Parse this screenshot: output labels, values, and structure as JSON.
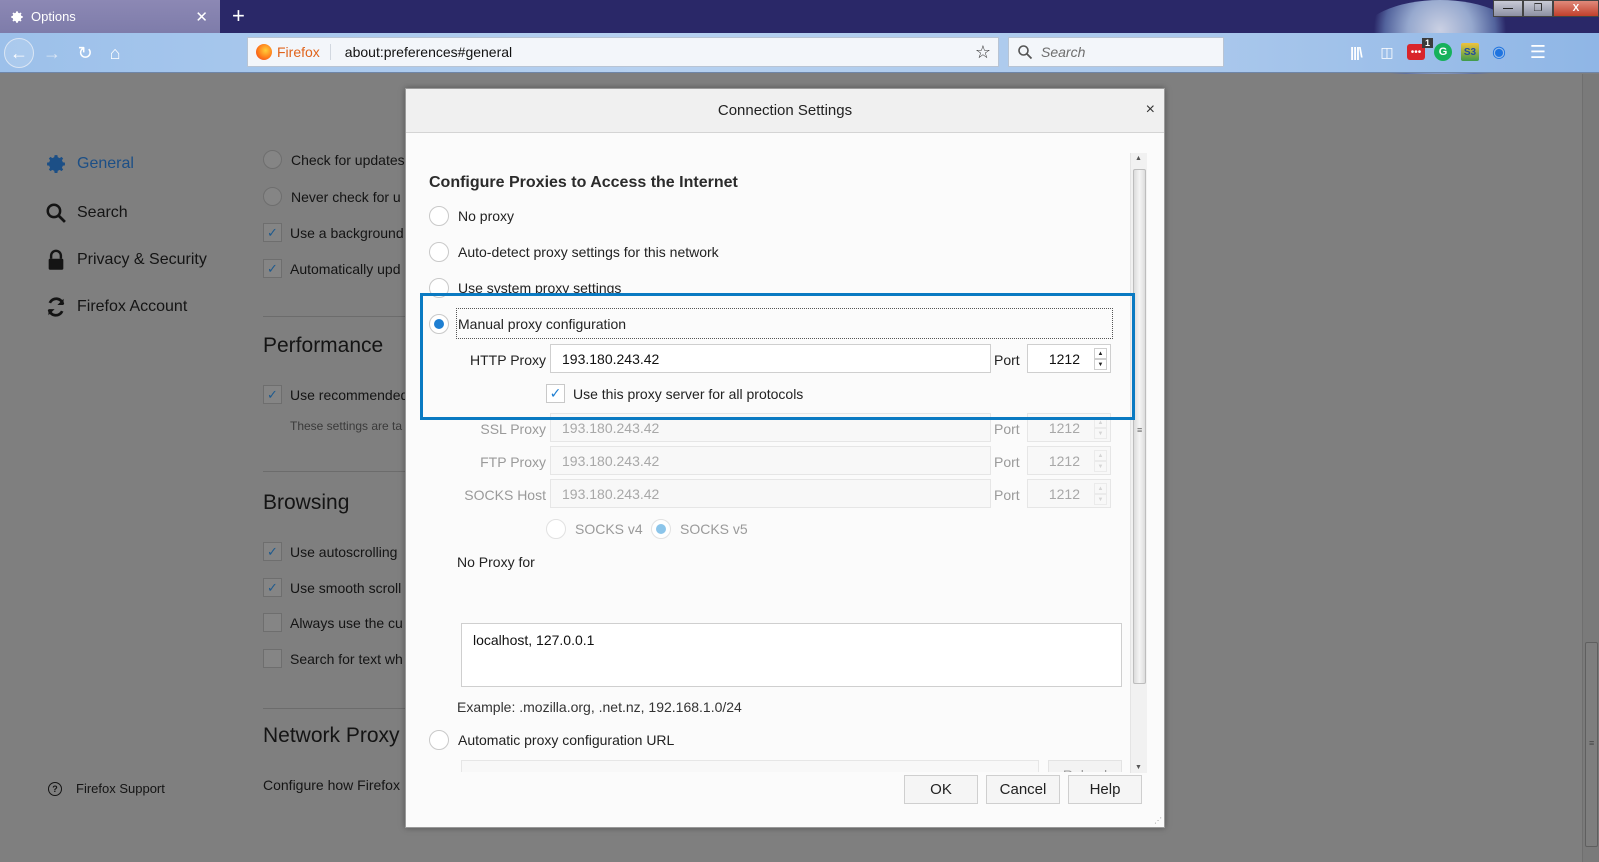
{
  "browser": {
    "tab": {
      "label": "Options",
      "icon": "gear-icon"
    },
    "new_tab_label": "+",
    "urlbar": {
      "identity_label": "Firefox",
      "url": "about:preferences#general"
    },
    "searchbar": {
      "placeholder": "Search"
    },
    "toolbar_icons": [
      "library-icon",
      "sidebar-icon",
      "extension-icon",
      "grammarly-icon",
      "s3-extension-icon",
      "eye-extension-icon",
      "menu-icon"
    ],
    "extension_badge": "1",
    "window_buttons": {
      "minimize": "—",
      "maximize": "❐",
      "close": "X"
    }
  },
  "sidebar": {
    "items": [
      {
        "label": "General",
        "icon": "gear-icon",
        "active": true
      },
      {
        "label": "Search",
        "icon": "search-icon",
        "active": false
      },
      {
        "label": "Privacy & Security",
        "icon": "lock-icon",
        "active": false
      },
      {
        "label": "Firefox Account",
        "icon": "sync-icon",
        "active": false
      }
    ],
    "support_label": "Firefox Support"
  },
  "prefs": {
    "updates": [
      {
        "type": "radio",
        "label": "Check for updates",
        "checked": false
      },
      {
        "type": "radio",
        "label": "Never check for u",
        "checked": false
      },
      {
        "type": "checkbox",
        "label": "Use a background",
        "checked": true
      },
      {
        "type": "checkbox",
        "label": "Automatically upd",
        "checked": true
      }
    ],
    "performance": {
      "title": "Performance",
      "option": {
        "label": "Use recommended",
        "checked": true
      },
      "note": "These settings are ta"
    },
    "browsing": {
      "title": "Browsing",
      "options": [
        {
          "label": "Use autoscrolling",
          "checked": true
        },
        {
          "label": "Use smooth scroll",
          "checked": true
        },
        {
          "label": "Always use the cu",
          "checked": false
        },
        {
          "label": "Search for text wh",
          "checked": false
        }
      ]
    },
    "network": {
      "title": "Network Proxy",
      "desc": "Configure how Firefox"
    }
  },
  "dialog": {
    "title": "Connection Settings",
    "close": "×",
    "heading": "Configure Proxies to Access the Internet",
    "proxy_modes": [
      {
        "label": "No proxy",
        "selected": false
      },
      {
        "label": "Auto-detect proxy settings for this network",
        "selected": false
      },
      {
        "label": "Use system proxy settings",
        "selected": false
      },
      {
        "label": "Manual proxy configuration",
        "selected": true
      }
    ],
    "http": {
      "label": "HTTP Proxy",
      "host": "193.180.243.42",
      "port_label": "Port",
      "port": "1212"
    },
    "use_for_all": {
      "label": "Use this proxy server for all protocols",
      "checked": true
    },
    "ssl": {
      "label": "SSL Proxy",
      "host": "193.180.243.42",
      "port_label": "Port",
      "port": "1212"
    },
    "ftp": {
      "label": "FTP Proxy",
      "host": "193.180.243.42",
      "port_label": "Port",
      "port": "1212"
    },
    "socks": {
      "label": "SOCKS Host",
      "host": "193.180.243.42",
      "port_label": "Port",
      "port": "1212"
    },
    "socks_versions": [
      {
        "label": "SOCKS v4",
        "selected": false
      },
      {
        "label": "SOCKS v5",
        "selected": true
      }
    ],
    "no_proxy": {
      "label": "No Proxy for",
      "value": "localhost, 127.0.0.1",
      "example": "Example: .mozilla.org, .net.nz, 192.168.1.0/24"
    },
    "auto_url": {
      "label": "Automatic proxy configuration URL",
      "selected": false,
      "value": "",
      "reload_label": "Reload"
    },
    "buttons": {
      "ok": "OK",
      "cancel": "Cancel",
      "help": "Help"
    },
    "highlight_color": "#0a7ac2"
  }
}
